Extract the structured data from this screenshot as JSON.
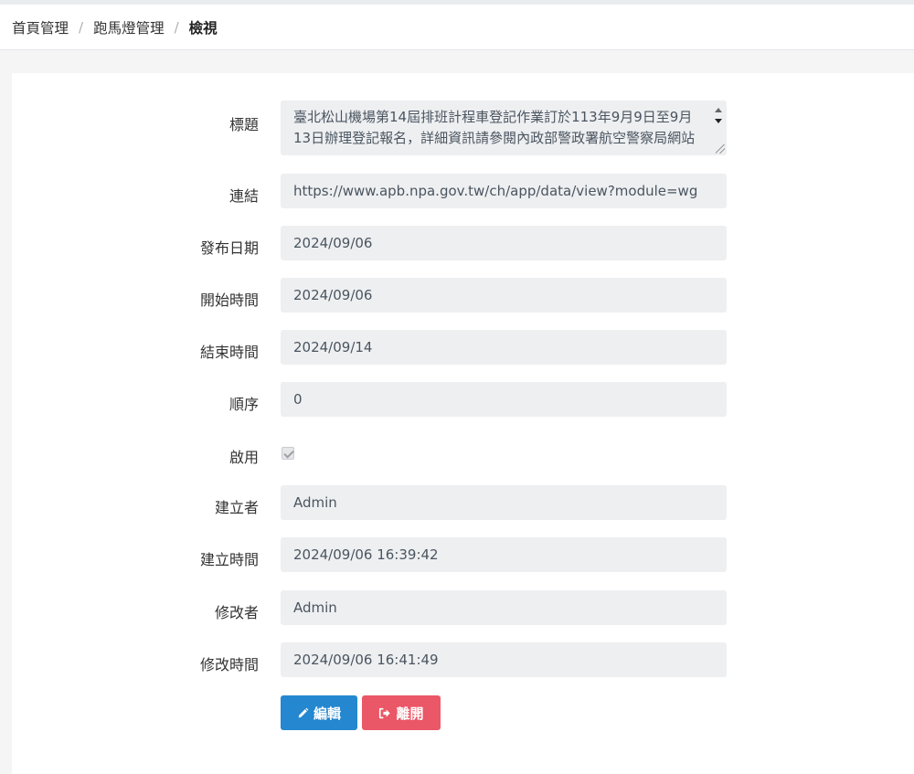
{
  "breadcrumb": {
    "items": [
      "首頁管理",
      "跑馬燈管理"
    ],
    "current": "檢視",
    "separator": "/"
  },
  "form": {
    "title_label": "標題",
    "title_value": "臺北松山機場第14屆排班計程車登記作業訂於113年9月9日至9月13日辦理登記報名，詳細資訊請參閱內政部警政署航空警察局網站",
    "link_label": "連結",
    "link_value": "https://www.apb.npa.gov.tw/ch/app/data/view?module=wg",
    "publish_date_label": "發布日期",
    "publish_date_value": "2024/09/06",
    "start_time_label": "開始時間",
    "start_time_value": "2024/09/06",
    "end_time_label": "結束時間",
    "end_time_value": "2024/09/14",
    "order_label": "順序",
    "order_value": "0",
    "enabled_label": "啟用",
    "creator_label": "建立者",
    "creator_value": "Admin",
    "created_time_label": "建立時間",
    "created_time_value": "2024/09/06 16:39:42",
    "modifier_label": "修改者",
    "modifier_value": "Admin",
    "modified_time_label": "修改時間",
    "modified_time_value": "2024/09/06 16:41:49"
  },
  "buttons": {
    "edit_label": "編輯",
    "leave_label": "離開"
  },
  "colors": {
    "edit": "#2587cf",
    "leave": "#ea5766"
  }
}
